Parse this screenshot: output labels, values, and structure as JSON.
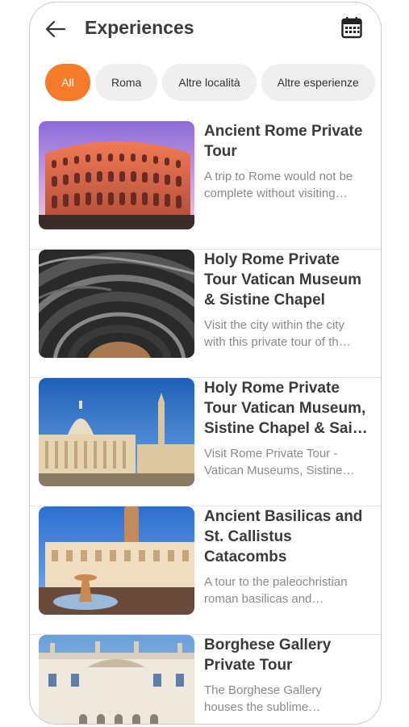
{
  "header": {
    "title": "Experiences",
    "back_icon": "arrow-left-icon",
    "calendar_icon": "calendar-icon"
  },
  "filters": [
    {
      "label": "All",
      "active": true
    },
    {
      "label": "Roma",
      "active": false
    },
    {
      "label": "Altre località",
      "active": false
    },
    {
      "label": "Altre esperienze",
      "active": false
    }
  ],
  "experiences": [
    {
      "title_lines": [
        "Ancient Rome Private",
        "Tour"
      ],
      "desc_lines": [
        "A trip to Rome would not be",
        "complete without visiting…"
      ],
      "image": "colosseum"
    },
    {
      "title_lines": [
        "Holy Rome Private",
        "Tour Vatican Museum",
        "& Sistine Chapel"
      ],
      "desc_lines": [
        "Visit the city within the city",
        "with this private tour of th…"
      ],
      "image": "vatican-spiral-staircase"
    },
    {
      "title_lines": [
        "Holy Rome Private",
        "Tour Vatican Museum,",
        "Sistine Chapel & Sain…"
      ],
      "desc_lines": [
        "Visit Rome Private Tour -",
        "Vatican Museums, Sistine…"
      ],
      "image": "st-peters-square"
    },
    {
      "title_lines": [
        "Ancient Basilicas and",
        "St. Callistus",
        "Catacombs"
      ],
      "desc_lines": [
        "A tour to the paleochristian",
        "roman basilicas and…"
      ],
      "image": "santa-maria-maggiore"
    },
    {
      "title_lines": [
        "Borghese Gallery",
        "Private Tour"
      ],
      "desc_lines": [
        "The Borghese Gallery",
        "houses the sublime…"
      ],
      "image": "villa-borghese"
    }
  ],
  "colors": {
    "accent": "#f57b2a",
    "chip_bg": "#efefef",
    "title_text": "#3a3a3a",
    "desc_text": "#8a8a8a"
  }
}
